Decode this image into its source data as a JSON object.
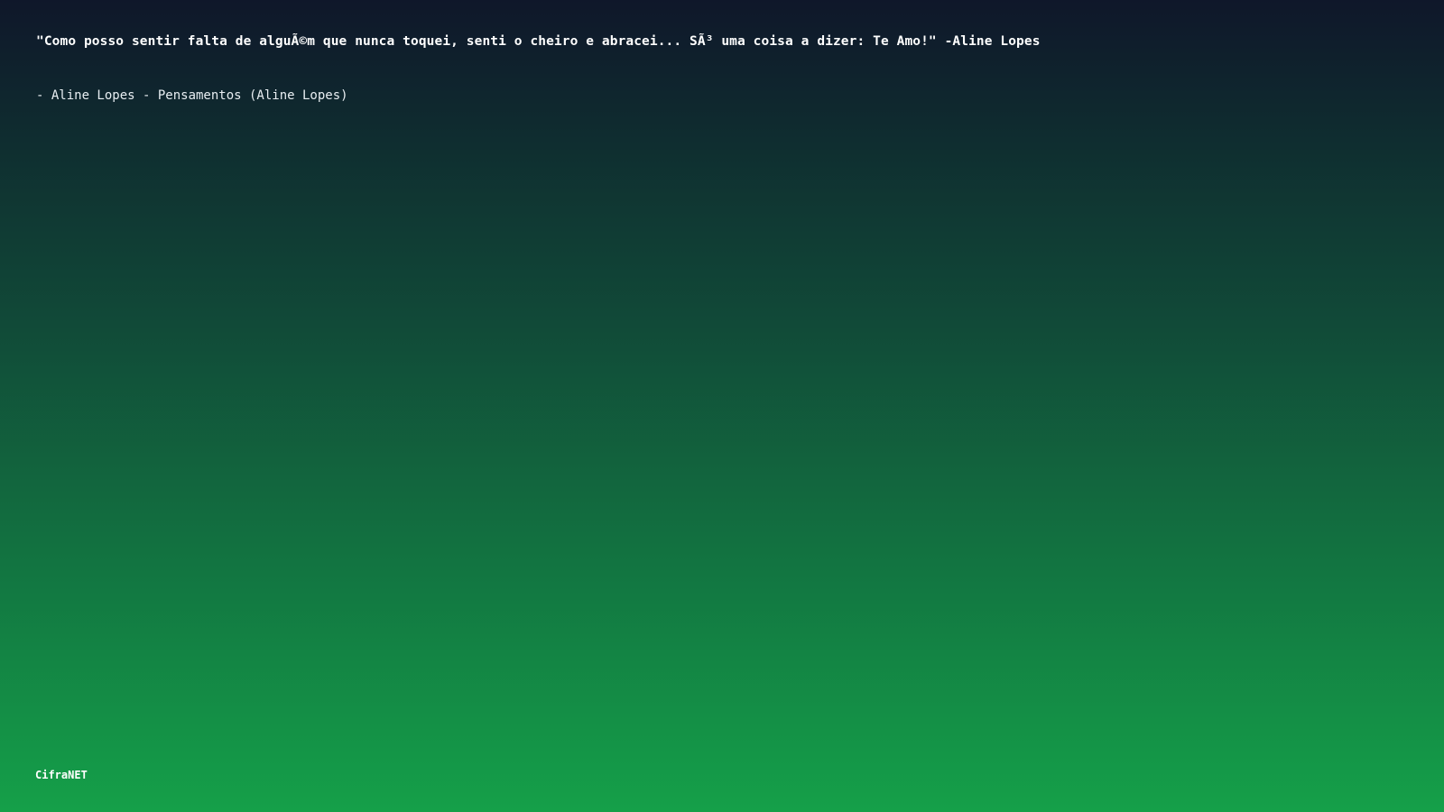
{
  "quote": {
    "text": "\"Como posso sentir falta de alguÃ©m que nunca toquei, senti o cheiro e abracei... SÃ³ uma coisa a dizer: Te Amo!\" -Aline Lopes"
  },
  "attribution": {
    "text": "- Aline Lopes - Pensamentos (Aline Lopes)"
  },
  "footer": {
    "brand": "CifraNET"
  }
}
